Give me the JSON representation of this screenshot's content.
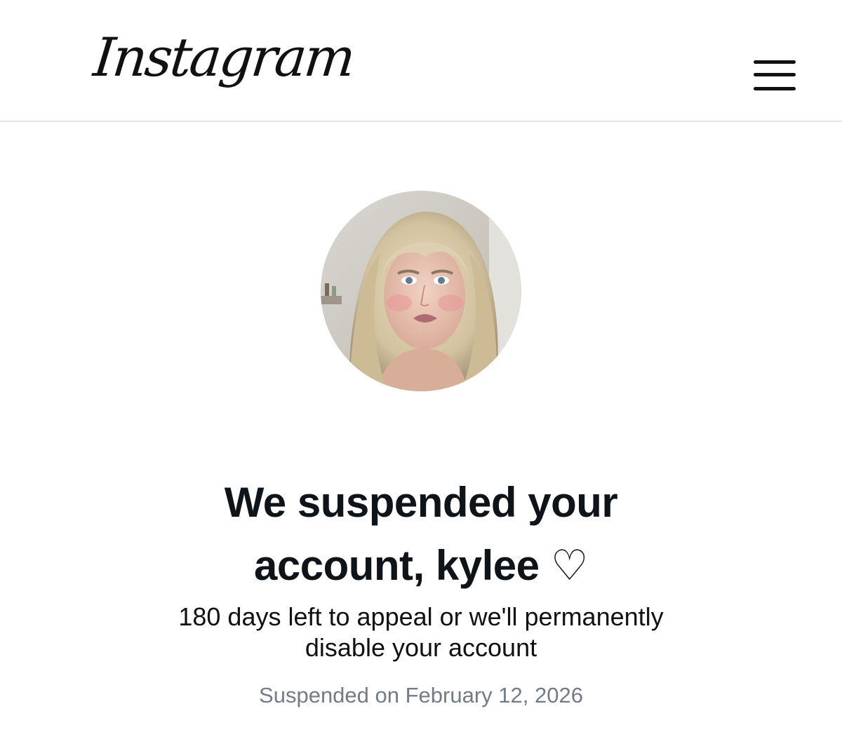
{
  "app": {
    "brand": "Instagram"
  },
  "header": {
    "menu_icon": "hamburger-menu-icon"
  },
  "profile": {
    "avatar_icon": "profile-photo",
    "username": "kylee"
  },
  "notice": {
    "title_line1": "We suspended your",
    "title_line2": "account, kylee ♡",
    "message_line1": "180 days left to appeal or we'll permanently",
    "message_line2": "disable your account",
    "date": "Suspended on February 12, 2026"
  },
  "colors": {
    "text": "#0f1419",
    "muted": "#737b85",
    "divider": "#e4e6eb"
  }
}
